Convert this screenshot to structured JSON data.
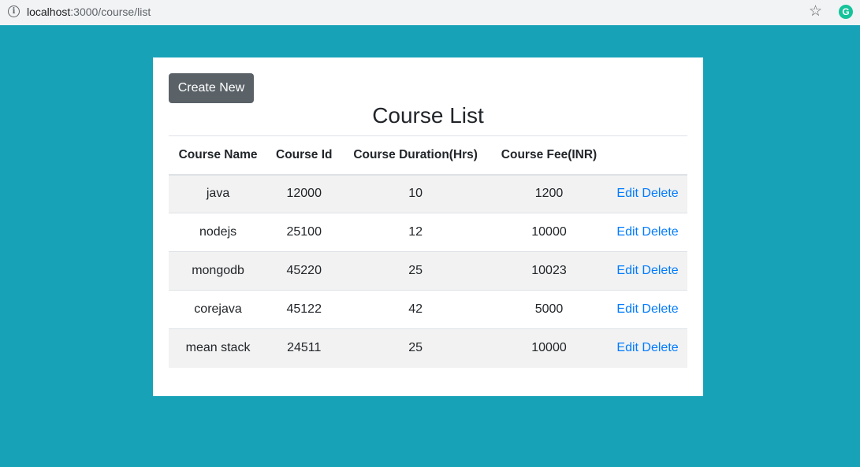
{
  "browser": {
    "url_host": "localhost",
    "url_path": ":3000/course/list"
  },
  "page": {
    "create_button": "Create New",
    "title": "Course List"
  },
  "table": {
    "headers": [
      "Course Name",
      "Course Id",
      "Course Duration(Hrs)",
      "Course Fee(INR)",
      ""
    ],
    "rows": [
      {
        "name": "java",
        "id": "12000",
        "duration": "10",
        "fee": "1200"
      },
      {
        "name": "nodejs",
        "id": "25100",
        "duration": "12",
        "fee": "10000"
      },
      {
        "name": "mongodb",
        "id": "45220",
        "duration": "25",
        "fee": "10023"
      },
      {
        "name": "corejava",
        "id": "45122",
        "duration": "42",
        "fee": "5000"
      },
      {
        "name": "mean stack",
        "id": "24511",
        "duration": "25",
        "fee": "10000"
      }
    ],
    "edit_label": "Edit",
    "delete_label": "Delete"
  },
  "colors": {
    "background": "#17a2b8",
    "button": "#5a6268",
    "link": "#007bff"
  },
  "icons": {
    "site_info": "info-icon",
    "bookmark": "star-icon",
    "extension": "grammarly-icon"
  }
}
